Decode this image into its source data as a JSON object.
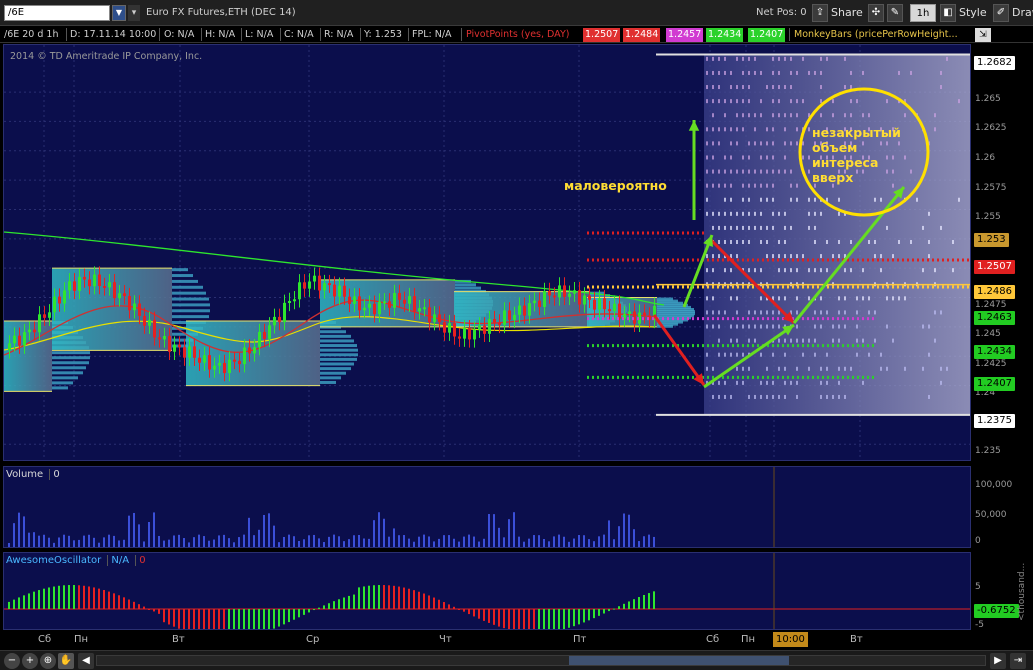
{
  "toolbar": {
    "symbol": "/6E",
    "instrument": "Euro FX Futures,ETH (DEC 14)",
    "net_pos": "Net Pos: 0",
    "share_label": "Share",
    "timeframe": "1h",
    "style_label": "Style",
    "drawings_label": "Drawings"
  },
  "infobar": {
    "aggregation": "/6E 20 d 1h",
    "date": "D: 17.11.14 10:00",
    "open": "O: N/A",
    "high": "H: N/A",
    "low": "L: N/A",
    "close": "C: N/A",
    "range": "R: N/A",
    "y": "Y: 1.253",
    "fpl": "FPL: N/A",
    "pivot_label": "PivotPoints (yes, DAY)",
    "pivot_values": [
      {
        "value": "1.2507",
        "color": "#e03030"
      },
      {
        "value": "1.2484",
        "color": "#e03030"
      },
      {
        "value": "1.2457",
        "color": "#d13bd1"
      },
      {
        "value": "1.2434",
        "color": "#2bd22b"
      },
      {
        "value": "1.2407",
        "color": "#2bd22b"
      }
    ],
    "monkeybars_label": "MonkeyBars (pricePerRowHeight..."
  },
  "price_panel": {
    "copyright": "2014 © TD Ameritrade IP Company, Inc.",
    "ticks": [
      "1.265",
      "1.2625",
      "1.26",
      "1.2575",
      "1.255",
      "1.2475",
      "1.245",
      "1.2425",
      "1.24",
      "1.235"
    ],
    "price_tags": [
      {
        "value": "1.2682",
        "bg": "#ffffff",
        "fg": "#000000"
      },
      {
        "value": "1.253",
        "bg": "#c9982e",
        "fg": "#000000"
      },
      {
        "value": "1.2507",
        "bg": "#e02020",
        "fg": "#ffffff"
      },
      {
        "value": "1.2486",
        "bg": "#ffc83a",
        "fg": "#000000"
      },
      {
        "value": "1.2463",
        "bg": "#22cc22",
        "fg": "#000000"
      },
      {
        "value": "1.2434",
        "bg": "#22cc22",
        "fg": "#000000"
      },
      {
        "value": "1.2407",
        "bg": "#22cc22",
        "fg": "#000000"
      },
      {
        "value": "1.2375",
        "bg": "#ffffff",
        "fg": "#000000"
      }
    ],
    "annotation_unlikely": "маловероятно",
    "annotation_volume": [
      "незакрытый",
      "объем",
      "интереса",
      "вверх"
    ]
  },
  "volume_panel": {
    "title": "Volume",
    "value": "0",
    "ticks": [
      "100,000",
      "50,000",
      "0"
    ]
  },
  "ao_panel": {
    "title": "AwesomeOscillator",
    "value1": "N/A",
    "value2": "0",
    "ticks": [
      "5",
      "0",
      "-5"
    ],
    "current_tag": "-0.6752",
    "side_label": "<thousand..."
  },
  "date_axis": {
    "labels": [
      "Сб",
      "Пн",
      "Вт",
      "Ср",
      "Чт",
      "Пт",
      "Сб",
      "Пн",
      "Вт"
    ],
    "time_marker": "10:00"
  },
  "colors": {
    "panel_bg": "#0b0e4c",
    "bull": "#2ee62e",
    "bear": "#e82020",
    "annotation": "#ffdd33"
  }
}
